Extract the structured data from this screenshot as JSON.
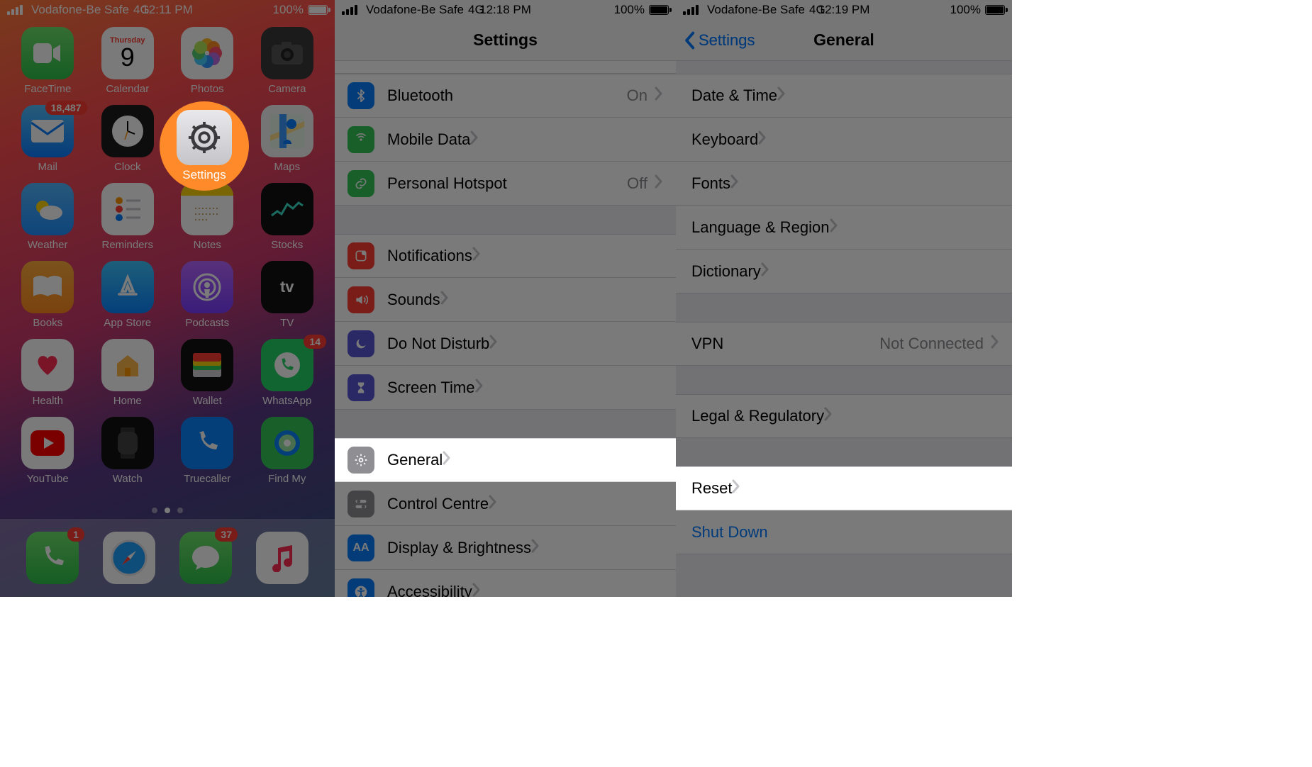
{
  "status": {
    "carrier": "Vodafone-Be Safe",
    "network": "4G",
    "battery_pct": "100%",
    "times": {
      "p1": "12:11 PM",
      "p2": "12:18 PM",
      "p3": "12:19 PM"
    }
  },
  "home": {
    "calendar_day": "Thursday",
    "calendar_date": "9",
    "apps": [
      {
        "name": "FaceTime",
        "icon": "facetime"
      },
      {
        "name": "Calendar",
        "icon": "calendar"
      },
      {
        "name": "Photos",
        "icon": "photos"
      },
      {
        "name": "Camera",
        "icon": "camera"
      },
      {
        "name": "Mail",
        "icon": "mail",
        "badge": "18,487"
      },
      {
        "name": "Clock",
        "icon": "clock"
      },
      {
        "name": "Settings",
        "icon": "settings",
        "highlight": true
      },
      {
        "name": "Maps",
        "icon": "maps"
      },
      {
        "name": "Weather",
        "icon": "weather"
      },
      {
        "name": "Reminders",
        "icon": "reminders"
      },
      {
        "name": "Notes",
        "icon": "notes"
      },
      {
        "name": "Stocks",
        "icon": "stocks"
      },
      {
        "name": "Books",
        "icon": "books"
      },
      {
        "name": "App Store",
        "icon": "appstore"
      },
      {
        "name": "Podcasts",
        "icon": "podcasts"
      },
      {
        "name": "TV",
        "icon": "tv"
      },
      {
        "name": "Health",
        "icon": "health"
      },
      {
        "name": "Home",
        "icon": "home"
      },
      {
        "name": "Wallet",
        "icon": "wallet"
      },
      {
        "name": "WhatsApp",
        "icon": "whatsapp",
        "badge": "14"
      },
      {
        "name": "YouTube",
        "icon": "youtube"
      },
      {
        "name": "Watch",
        "icon": "watch"
      },
      {
        "name": "Truecaller",
        "icon": "truecaller"
      },
      {
        "name": "Find My",
        "icon": "findmy"
      }
    ],
    "dock": [
      {
        "name": "Phone",
        "icon": "phone",
        "badge": "1"
      },
      {
        "name": "Safari",
        "icon": "safari"
      },
      {
        "name": "Messages",
        "icon": "messages",
        "badge": "37"
      },
      {
        "name": "Music",
        "icon": "music"
      }
    ]
  },
  "settings": {
    "title": "Settings",
    "rows": [
      {
        "label": "Bluetooth",
        "value": "On",
        "icon_color": "#0a7eff",
        "glyph": "bt"
      },
      {
        "label": "Mobile Data",
        "icon_color": "#34c759",
        "glyph": "antenna"
      },
      {
        "label": "Personal Hotspot",
        "value": "Off",
        "icon_color": "#34c759",
        "glyph": "link"
      }
    ],
    "rows2": [
      {
        "label": "Notifications",
        "icon_color": "#ff3b30",
        "glyph": "notif"
      },
      {
        "label": "Sounds",
        "icon_color": "#ff3b30",
        "glyph": "speaker"
      },
      {
        "label": "Do Not Disturb",
        "icon_color": "#5856d6",
        "glyph": "moon"
      },
      {
        "label": "Screen Time",
        "icon_color": "#5856d6",
        "glyph": "hourglass"
      }
    ],
    "rows3": [
      {
        "label": "General",
        "icon_color": "#8e8e93",
        "glyph": "gear",
        "highlight": true
      },
      {
        "label": "Control Centre",
        "icon_color": "#8e8e93",
        "glyph": "switches"
      },
      {
        "label": "Display & Brightness",
        "icon_color": "#0a7eff",
        "glyph": "AA"
      },
      {
        "label": "Accessibility",
        "icon_color": "#0a7eff",
        "glyph": "access"
      }
    ]
  },
  "general": {
    "back_label": "Settings",
    "title": "General",
    "sect1": [
      {
        "label": "Date & Time"
      },
      {
        "label": "Keyboard"
      },
      {
        "label": "Fonts"
      },
      {
        "label": "Language & Region"
      },
      {
        "label": "Dictionary"
      }
    ],
    "sect2": [
      {
        "label": "VPN",
        "value": "Not Connected"
      }
    ],
    "sect3": [
      {
        "label": "Legal & Regulatory"
      }
    ],
    "sect4": [
      {
        "label": "Reset",
        "highlight": true
      },
      {
        "label": "Shut Down",
        "style": "link"
      }
    ]
  }
}
